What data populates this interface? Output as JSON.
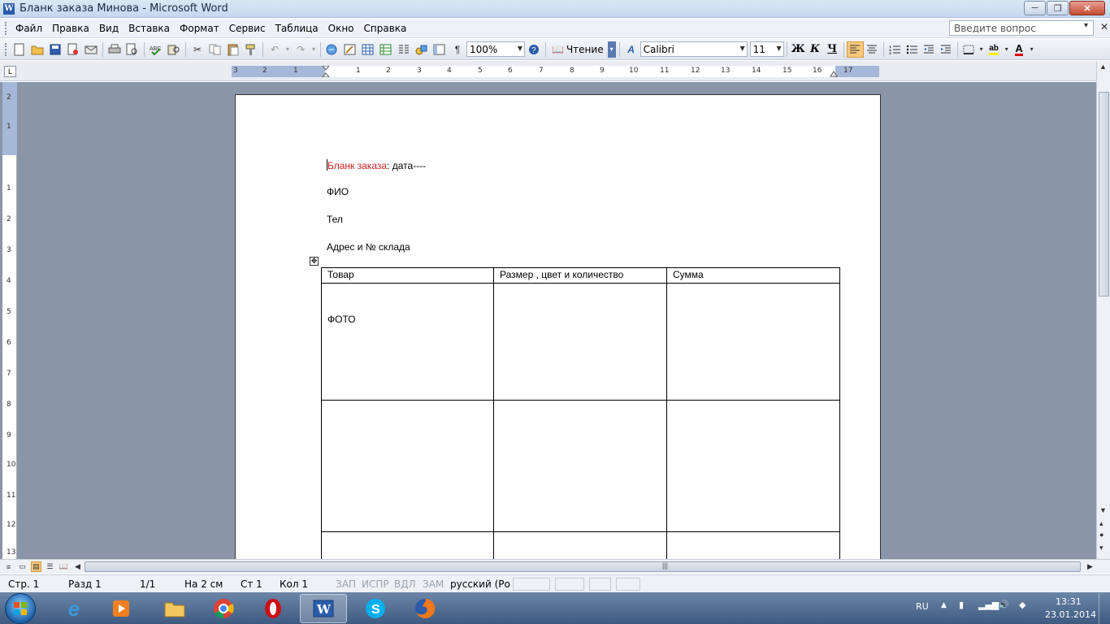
{
  "window": {
    "title": "Бланк заказа Минова - Microsoft Word",
    "app_icon": "W",
    "controls": {
      "minimize": "─",
      "maximize": "❐",
      "close": "✕"
    }
  },
  "menubar": {
    "items": [
      {
        "label": "Файл",
        "accel": "Ф"
      },
      {
        "label": "Правка",
        "accel": "П"
      },
      {
        "label": "Вид",
        "accel": "В"
      },
      {
        "label": "Вставка",
        "accel": "с"
      },
      {
        "label": "Формат",
        "accel": "о"
      },
      {
        "label": "Сервис",
        "accel": "е"
      },
      {
        "label": "Таблица",
        "accel": "Т"
      },
      {
        "label": "Окно",
        "accel": "О"
      },
      {
        "label": "Справка",
        "accel": "С"
      }
    ],
    "help_placeholder": "Введите вопрос",
    "help_arrow": "▾",
    "close_doc": "✕"
  },
  "toolbar": {
    "zoom": "100%",
    "reading_label": "Чтение",
    "font_name": "Calibri",
    "font_size": "11",
    "bold_label": "Ж",
    "italic_label": "К",
    "underline_label": "Ч",
    "pilcrow": "¶",
    "font_color_label": "A",
    "highlight_label": "ab"
  },
  "ruler": {
    "corner": "L",
    "h_ticks": [
      "3",
      "2",
      "1",
      "1",
      "2",
      "3",
      "4",
      "5",
      "6",
      "7",
      "8",
      "9",
      "10",
      "11",
      "12",
      "13",
      "14",
      "15",
      "16",
      "17"
    ],
    "v_ticks": [
      "2",
      "1",
      "1",
      "2",
      "3",
      "4",
      "5",
      "6",
      "7",
      "8",
      "9",
      "10",
      "11",
      "12",
      "13"
    ]
  },
  "document": {
    "line1_red": "Бланк заказа",
    "line1_rest": ": дата----",
    "line2": "ФИО",
    "line3": "Тел",
    "line4": "Адрес и № склада",
    "table": {
      "headers": [
        "Товар",
        "Размер , цвет и количество",
        "Сумма"
      ],
      "row1_cell1": "ФОТО"
    }
  },
  "statusbar": {
    "page": "Стр. 1",
    "section": "Разд 1",
    "pages": "1/1",
    "at": "На 2 см",
    "line": "Ст 1",
    "col": "Кол 1",
    "rec": "ЗАП",
    "trk": "ИСПР",
    "ext": "ВДЛ",
    "ovr": "ЗАМ",
    "language": "русский (Ро"
  },
  "taskbar": {
    "language": "RU",
    "time": "13:31",
    "date": "23.01.2014",
    "apps": [
      "ie",
      "media",
      "explorer",
      "chrome",
      "opera",
      "word",
      "skype",
      "firefox"
    ]
  }
}
